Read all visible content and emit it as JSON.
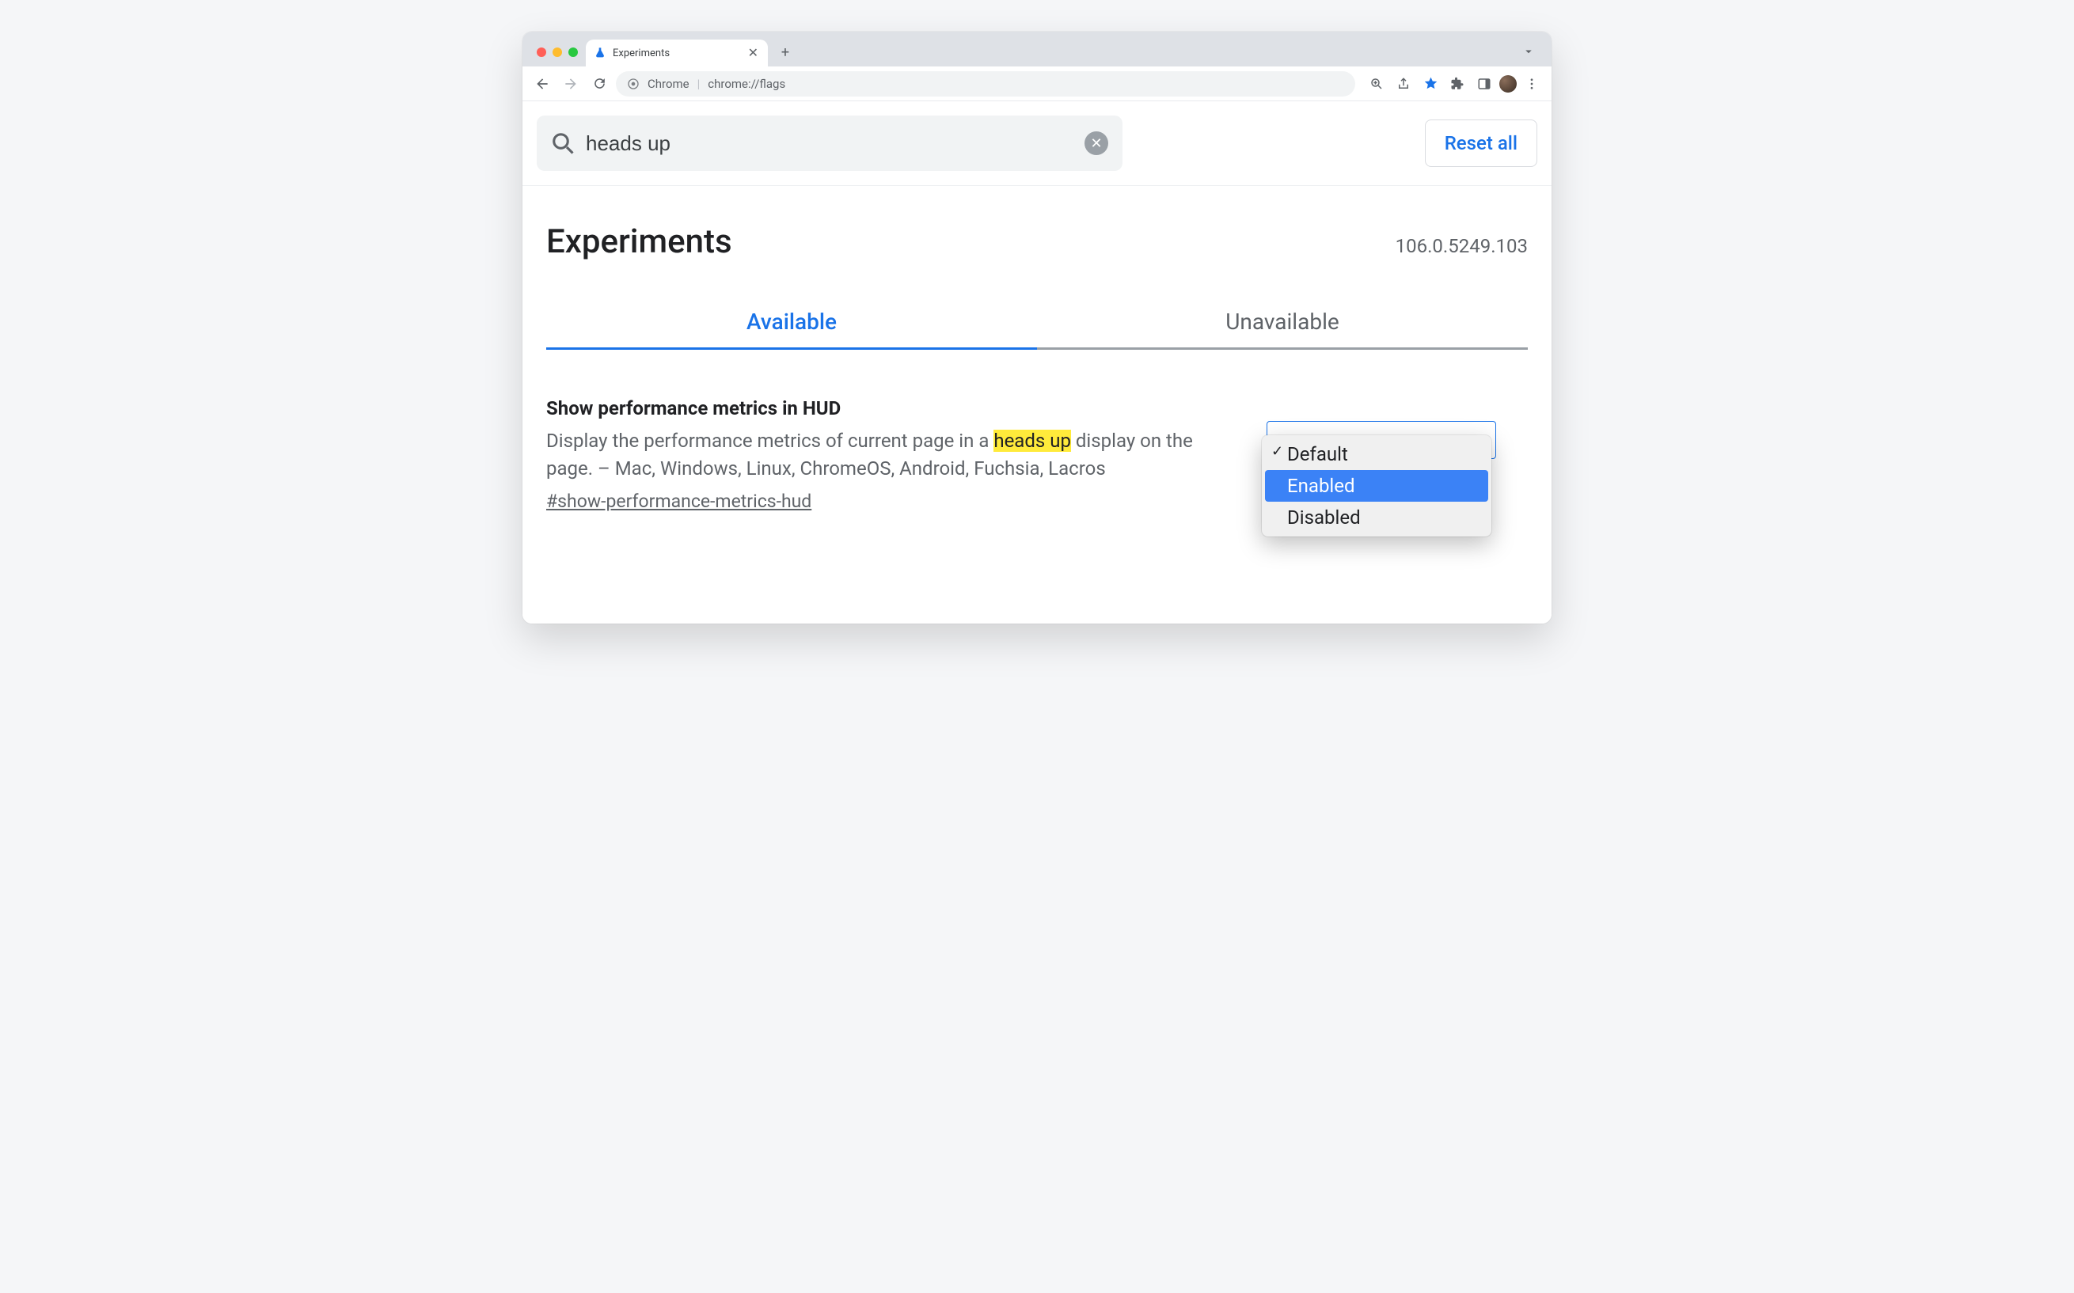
{
  "window": {
    "tab_title": "Experiments",
    "omnibox_prefix": "Chrome",
    "omnibox_url": "chrome://flags"
  },
  "search": {
    "value": "heads up",
    "reset_label": "Reset all"
  },
  "header": {
    "title": "Experiments",
    "version": "106.0.5249.103"
  },
  "tabs": {
    "available": "Available",
    "unavailable": "Unavailable"
  },
  "flag": {
    "title": "Show performance metrics in HUD",
    "desc_pre": "Display the performance metrics of current page in a ",
    "desc_highlight": "heads up",
    "desc_post": " display on the page. – Mac, Windows, Linux, ChromeOS, Android, Fuchsia, Lacros",
    "anchor": "#show-performance-metrics-hud"
  },
  "dropdown": {
    "options": [
      "Default",
      "Enabled",
      "Disabled"
    ],
    "selected": "Default",
    "highlighted": "Enabled"
  }
}
